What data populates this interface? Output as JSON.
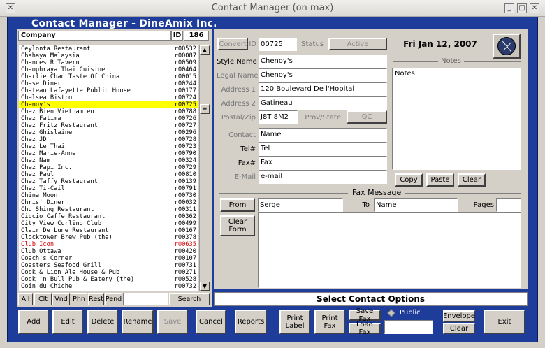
{
  "window": {
    "title": "Contact Manager (on max)",
    "app_title": "Contact Manager - DineAmix Inc."
  },
  "list": {
    "col_company": "Company",
    "col_id": "ID",
    "count": "186",
    "items": [
      {
        "name": "Ceylonta Restaurant",
        "id": "r00532"
      },
      {
        "name": "Chahaya Malaysia",
        "id": "r00087"
      },
      {
        "name": "Chances R Tavern",
        "id": "r00509"
      },
      {
        "name": "Chaophraya Thai Cuisine",
        "id": "r00464"
      },
      {
        "name": "Charlie Chan Taste Of China",
        "id": "r00015"
      },
      {
        "name": "Chase Diner",
        "id": "r00244"
      },
      {
        "name": "Chateau Lafayette Public House",
        "id": "r00177"
      },
      {
        "name": "Chelsea Bistro",
        "id": "r00724"
      },
      {
        "name": "Chenoy's",
        "id": "r00725",
        "selected": true
      },
      {
        "name": "Chez Bien Vietnamien",
        "id": "r00788"
      },
      {
        "name": "Chez Fatima",
        "id": "r00726"
      },
      {
        "name": "Chez Fritz Restaurant",
        "id": "r00727"
      },
      {
        "name": "Chez Ghislaine",
        "id": "r00296"
      },
      {
        "name": "Chez JD",
        "id": "r00728"
      },
      {
        "name": "Chez Le Thai",
        "id": "r00723"
      },
      {
        "name": "Chez Marie-Anne",
        "id": "r00790"
      },
      {
        "name": "Chez Nam",
        "id": "r00324"
      },
      {
        "name": "Chez Papi Inc.",
        "id": "r00729"
      },
      {
        "name": "Chez Paul",
        "id": "r00810"
      },
      {
        "name": "Chez Taffy Restaurant",
        "id": "r00139"
      },
      {
        "name": "Chez Ti-Cail",
        "id": "r00791"
      },
      {
        "name": "China Moon",
        "id": "r00730"
      },
      {
        "name": "Chris' Diner",
        "id": "r00032"
      },
      {
        "name": "Chu Shing Restaurant",
        "id": "r00311"
      },
      {
        "name": "Ciccio Caffe Restaurant",
        "id": "r00362"
      },
      {
        "name": "City View Curling Club",
        "id": "r00499"
      },
      {
        "name": "Clair De Lune Restaurant",
        "id": "r00167"
      },
      {
        "name": "Clocktower Brew Pub (the)",
        "id": "r00378"
      },
      {
        "name": "Club Icon",
        "id": "r00635",
        "red": true
      },
      {
        "name": "Club Ottawa",
        "id": "r00420"
      },
      {
        "name": "Coach's Corner",
        "id": "r00107"
      },
      {
        "name": "Coasters Seafood Grill",
        "id": "r00731"
      },
      {
        "name": "Cock & Lion Ale House & Pub",
        "id": "r00271"
      },
      {
        "name": "Cock 'n Bull Pub & Eatery (the)",
        "id": "r00528"
      },
      {
        "name": "Coin du Chiche",
        "id": "r00732"
      }
    ]
  },
  "filters": {
    "all": "All",
    "clt": "Clt",
    "vnd": "Vnd",
    "phn": "Phn",
    "rest": "Rest",
    "pend": "Pend",
    "search_value": "",
    "search": "Search"
  },
  "record": {
    "convert": "Convert",
    "id_label": "ID",
    "id": "00725",
    "status_label": "Status",
    "status": "Active",
    "date": "Fri Jan 12, 2007",
    "style_name_label": "Style Name",
    "style_name": "Chenoy's",
    "legal_name_label": "Legal Name",
    "legal_name": "Chenoy's",
    "address1_label": "Address 1",
    "address1": "120 Boulevard De l'Hopital",
    "address2_label": "Address 2",
    "address2": "Gatineau",
    "postal_label": "Postal/Zip",
    "postal": "J8T 8M2",
    "prov_label": "Prov/State",
    "prov": "QC",
    "contact_label": "Contact",
    "contact": "Name",
    "tel_label": "Tel#",
    "tel": "Tel",
    "fax_label": "Fax#",
    "fax": "Fax",
    "email_label": "E-Mail",
    "email": "e-mail"
  },
  "notes": {
    "title": "Notes",
    "text": "Notes",
    "copy": "Copy",
    "paste": "Paste",
    "clear": "Clear"
  },
  "fax_msg": {
    "title": "Fax Message",
    "from_btn": "From",
    "from": "Serge",
    "to_label": "To",
    "to": "Name",
    "pages_label": "Pages",
    "pages": "",
    "clear_form": "Clear Form"
  },
  "status_bar": "Select Contact Options",
  "toolbar": {
    "add": "Add",
    "edit": "Edit",
    "delete": "Delete",
    "rename": "Rename",
    "save": "Save",
    "cancel": "Cancel",
    "reports": "Reports",
    "print_label": "Print Label",
    "print_fax": "Print Fax",
    "save_fax": "Save Fax",
    "load_fax": "Load Fax",
    "public": "Public",
    "envelope": "Envelope",
    "env_clear": "Clear",
    "exit": "Exit"
  }
}
